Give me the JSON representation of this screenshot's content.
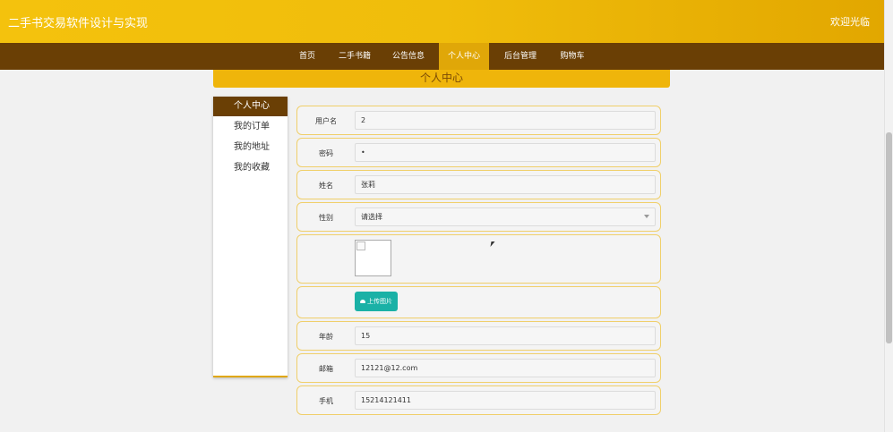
{
  "header": {
    "title": "二手书交易软件设计与实现",
    "welcome": "欢迎光临"
  },
  "nav": {
    "items": [
      {
        "label": "首页"
      },
      {
        "label": "二手书籍"
      },
      {
        "label": "公告信息"
      },
      {
        "label": "个人中心",
        "active": true
      },
      {
        "label": "后台管理"
      },
      {
        "label": "购物车"
      }
    ]
  },
  "banner": {
    "title": "个人中心"
  },
  "sidebar": {
    "items": [
      {
        "label": "个人中心",
        "active": true
      },
      {
        "label": "我的订单"
      },
      {
        "label": "我的地址"
      },
      {
        "label": "我的收藏"
      }
    ]
  },
  "form": {
    "username": {
      "label": "用户名",
      "value": "2"
    },
    "password": {
      "label": "密码",
      "value": "•"
    },
    "name": {
      "label": "姓名",
      "value": "张莉"
    },
    "gender": {
      "label": "性别",
      "value": "请选择"
    },
    "upload": {
      "label": "上传图片"
    },
    "age": {
      "label": "年龄",
      "value": "15"
    },
    "email": {
      "label": "邮箱",
      "value": "12121@12.com"
    },
    "phone": {
      "label": "手机",
      "value": "15214121411"
    }
  },
  "colors": {
    "header_start": "#f4c20d",
    "header_end": "#e2a700",
    "nav_bg": "#6a3f05",
    "accent": "#e0a708",
    "upload_btn": "#1ab1a6"
  }
}
